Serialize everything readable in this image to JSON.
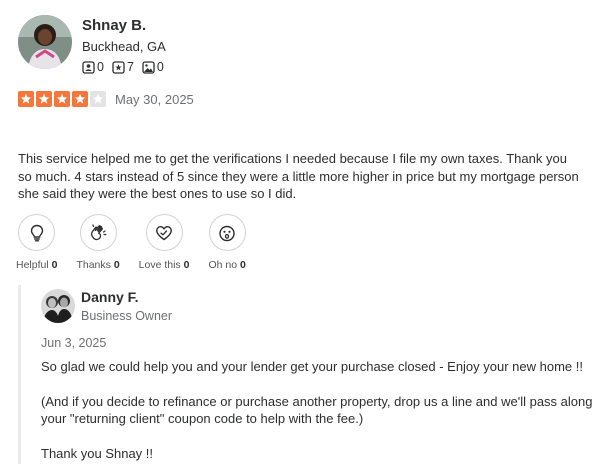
{
  "review": {
    "reviewer_name": "Shnay B.",
    "reviewer_location": "Buckhead, GA",
    "stats": {
      "friends": "0",
      "reviews": "7",
      "photos": "0"
    },
    "rating": 4,
    "max_rating": 5,
    "date": "May 30, 2025",
    "text": "This service helped me to get the verifications I needed because I file my own taxes. Thank you so much. 4 stars instead of 5 since they were a little more higher in price but my mortgage person she said they were the best ones to use so I did."
  },
  "reactions": [
    {
      "label": "Helpful",
      "count": "0",
      "icon": "lightbulb-icon"
    },
    {
      "label": "Thanks",
      "count": "0",
      "icon": "clapping-hands-icon"
    },
    {
      "label": "Love this",
      "count": "0",
      "icon": "heart-icon"
    },
    {
      "label": "Oh no",
      "count": "0",
      "icon": "surprised-face-icon"
    }
  ],
  "owner_response": {
    "name": "Danny F.",
    "role": "Business Owner",
    "date": "Jun 3, 2025",
    "paragraphs": [
      "So glad we could help you and your lender get your purchase closed - Enjoy your new home !!",
      "(And if you decide to refinance or purchase another property, drop us a line and we'll pass along your \"returning client\" coupon code to help with the fee.)",
      "Thank you Shnay !!"
    ]
  },
  "colors": {
    "star_on": "#f5763b",
    "star_off": "#e3e3e3"
  }
}
